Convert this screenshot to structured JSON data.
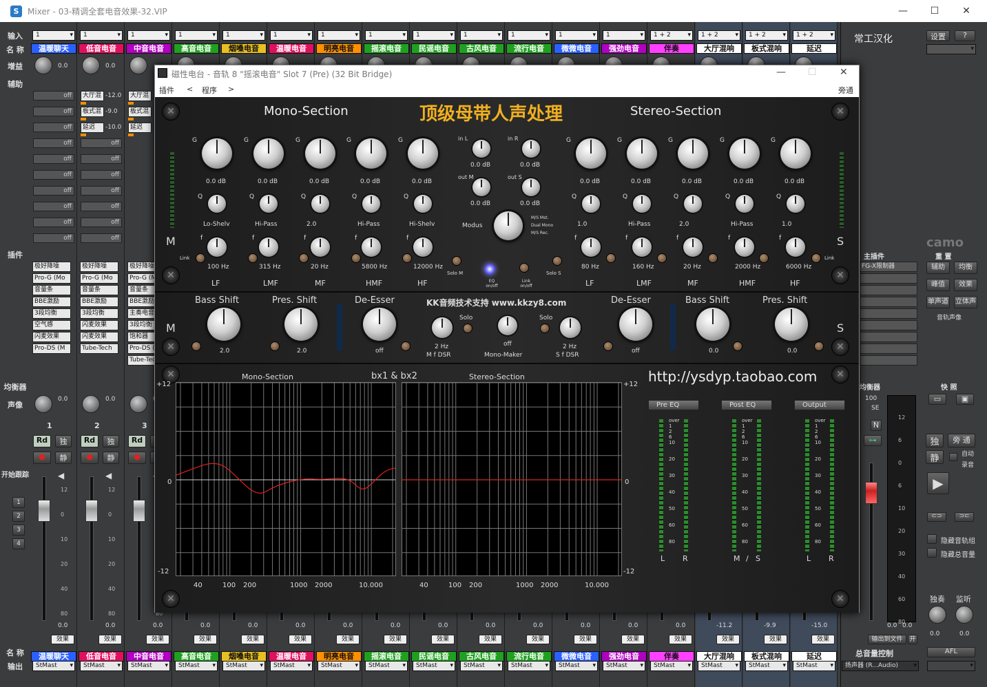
{
  "window": {
    "title": "Mixer - 03-精调全套电音效果-32.VIP",
    "icon_letter": "S"
  },
  "top_labels": {
    "input": "输入",
    "name": "名 称",
    "gain": "增益",
    "aux": "辅助",
    "insert": "插件",
    "eq": "均衡器",
    "pan": "声像",
    "start_follow": "开始跟踪",
    "name_bottom": "名 称",
    "output": "输出"
  },
  "strips": [
    {
      "num": "1",
      "input": "1",
      "name": "温暖聊天",
      "color": "#2a60ff",
      "text": "#fff",
      "gain": "0.0",
      "pan": "0.0",
      "sends": [],
      "inserts": [
        "极好降噪",
        "Pro-G (Mo",
        "音量条",
        "BBE激励",
        "3段均衡",
        "空气感",
        "闪麦效果",
        "Pro-DS (M"
      ],
      "vol": "0.0",
      "out": "StMast"
    },
    {
      "num": "2",
      "input": "1",
      "name": "低音电音",
      "color": "#e01060",
      "text": "#fff",
      "gain": "0.0",
      "pan": "0.0",
      "sends": [
        {
          "n": "大厅混",
          "v": "-12.0"
        },
        {
          "n": "板式混",
          "v": "-9.0"
        },
        {
          "n": "延迟",
          "v": "-10.0"
        }
      ],
      "inserts": [
        "极好降噪",
        "Pro-G (Mo",
        "音量条",
        "BBE激励",
        "3段均衡",
        "闪麦效果",
        "闪麦效果",
        "Tube-Tech"
      ],
      "vol": "0.0",
      "out": "StMast"
    },
    {
      "num": "3",
      "input": "1",
      "name": "中音电音",
      "color": "#b000c0",
      "text": "#fff",
      "gain": "",
      "pan": "0.0",
      "sends": [
        {
          "n": "大厅混",
          "v": ""
        },
        {
          "n": "板式混",
          "v": ""
        },
        {
          "n": "延迟",
          "v": ""
        }
      ],
      "inserts": [
        "极好降噪",
        "Pro-G (Mo",
        "音量条",
        "BBE激励",
        "主奏电音",
        "3段均衡",
        "饱和器",
        "Pro-DS (M",
        "Tube-Tec"
      ],
      "vol": "0.0",
      "out": "StMast"
    },
    {
      "num": "",
      "input": "1",
      "name": "高音电音",
      "color": "#20a020",
      "text": "#fff",
      "gain": "",
      "pan": "",
      "vol": "0.0",
      "out": "StMast"
    },
    {
      "num": "",
      "input": "1",
      "name": "烟嗓电音",
      "color": "#e8c020",
      "text": "#111",
      "gain": "",
      "pan": "",
      "vol": "0.0",
      "out": "StMast"
    },
    {
      "num": "",
      "input": "1",
      "name": "温暖电音",
      "color": "#e01060",
      "text": "#fff",
      "gain": "",
      "pan": "",
      "vol": "0.0",
      "out": "StMast"
    },
    {
      "num": "",
      "input": "1",
      "name": "明亮电音",
      "color": "#ff9000",
      "text": "#111",
      "gain": "",
      "pan": "",
      "vol": "0.0",
      "out": "StMast"
    },
    {
      "num": "",
      "input": "1",
      "name": "摇滚电音",
      "color": "#20a020",
      "text": "#fff",
      "gain": "",
      "pan": "",
      "vol": "0.0",
      "out": "StMast"
    },
    {
      "num": "",
      "input": "1",
      "name": "民谣电音",
      "color": "#20a020",
      "text": "#fff",
      "gain": "",
      "pan": "",
      "vol": "0.0",
      "out": "StMast"
    },
    {
      "num": "",
      "input": "1",
      "name": "古风电音",
      "color": "#20a020",
      "text": "#fff",
      "gain": "",
      "pan": "",
      "vol": "0.0",
      "out": "StMast"
    },
    {
      "num": "",
      "input": "1",
      "name": "流行电音",
      "color": "#20a020",
      "text": "#fff",
      "gain": "",
      "pan": "",
      "vol": "0.0",
      "out": "StMast"
    },
    {
      "num": "",
      "input": "1",
      "name": "微微电音",
      "color": "#2a60ff",
      "text": "#fff",
      "gain": "",
      "pan": "",
      "vol": "0.0",
      "out": "StMast"
    },
    {
      "num": "",
      "input": "1",
      "name": "强劲电音",
      "color": "#b000c0",
      "text": "#fff",
      "gain": "",
      "pan": "",
      "vol": "0.0",
      "out": "StMast"
    },
    {
      "num": "",
      "input": "1 + 2",
      "name": "伴奏",
      "color": "#ff40ff",
      "text": "#111",
      "gain": "",
      "pan": "",
      "vol": "0.0",
      "out": "StMast"
    },
    {
      "num": "",
      "input": "1 + 2",
      "name": "大厅混响",
      "color": "#ffffff",
      "text": "#111",
      "gain": "",
      "pan": "",
      "vol": "-11.2",
      "out": "StMast"
    },
    {
      "num": "",
      "input": "1 + 2",
      "name": "板式混响",
      "color": "#ffffff",
      "text": "#111",
      "gain": "",
      "pan": "",
      "vol": "-9.9",
      "out": "StMast"
    },
    {
      "num": "",
      "input": "1 + 2",
      "name": "延迟",
      "color": "#ffffff",
      "text": "#111",
      "gain": "",
      "pan": "",
      "vol": "-15.0",
      "out": "StMast"
    }
  ],
  "master": {
    "brand": "常工汉化",
    "settings": "设置",
    "help": "?",
    "master_insert": "主插件",
    "insert_name": "FG-X限制器",
    "rec_label": "重 置",
    "buttons": [
      "辅助",
      "均衡",
      "峰值",
      "效果",
      "单声道",
      "立体声"
    ],
    "pan_label": "音轨声像",
    "eq_label": "均衡器",
    "pan_value": "100",
    "se": "SE",
    "quick": "快 照",
    "solo": "独",
    "bypass": "旁 通",
    "mute": "静",
    "auto": "自动",
    "record": "录音",
    "hide_track": "隐藏音轨组",
    "hide_total": "隐藏总音量",
    "solo_label": "独奏",
    "monitor": "监听",
    "monitor_v": "0.0",
    "solo_v": "0.0",
    "to_file": "输出到文件",
    "on": "开",
    "master_name": "总音量控制",
    "out_device": "扬声器 (R...Audio)",
    "afl": "AFL",
    "master_vol": "0.0",
    "master_vol2": "0.0",
    "camo": "camo",
    "pan_small": "0.0"
  },
  "labels": {
    "off": "off",
    "rd": "Rd",
    "solo": "独",
    "mute": "静",
    "effect": "效果",
    "n": "N"
  },
  "plugin": {
    "title": "磁性电台 - 音轨 8  \"摇滚电音\" Slot 7 (Pre) (32 Bit Bridge)",
    "menu_plugin": "插件",
    "menu_prev": "<",
    "menu_program": "程序",
    "menu_next": ">",
    "bypass": "旁通",
    "mono_section": "Mono-Section",
    "stereo_section": "Stereo-Section",
    "banner": "顶级母带人声处理",
    "gain_vals": [
      "0.0 dB",
      "0.0 dB",
      "0.0 dB",
      "0.0 dB",
      "0.0 dB",
      "0.0 dB",
      "0.0 dB",
      "0.0 dB",
      "0.0 dB",
      "0.0 dB"
    ],
    "mono_q": [
      "Lo-Shelv",
      "Hi-Pass",
      "2.0",
      "Hi-Pass",
      "Hi-Shelv"
    ],
    "stereo_q": [
      "1.0",
      "Hi-Pass",
      "2.0",
      "Hi-Pass",
      "1.0"
    ],
    "mono_f": [
      "100 Hz",
      "315 Hz",
      "20 Hz",
      "5800 Hz",
      "12000 Hz"
    ],
    "stereo_f": [
      "80 Hz",
      "160 Hz",
      "20 Hz",
      "2000 Hz",
      "6000 Hz"
    ],
    "bands": [
      "LF",
      "LMF",
      "MF",
      "HMF",
      "HF"
    ],
    "in_l": "in L",
    "in_r": "in R",
    "out_m": "out M",
    "out_s": "out S",
    "io_vals": [
      "0.0 dB",
      "0.0 dB",
      "0.0 dB",
      "0.0 dB"
    ],
    "modus": "Modus",
    "modus_opts": [
      "M/S Mst.",
      "Dual Mono",
      "M/S Rec."
    ],
    "solo_m": "Solo M",
    "eq_onoff": "EQ on/off",
    "link_onoff": "Link on/off",
    "solo_s": "Solo S",
    "g": "G",
    "q": "Q",
    "f": "f",
    "link": "Link",
    "m": "M",
    "s": "S",
    "bass_shift": "Bass Shift",
    "pres_shift": "Pres. Shift",
    "de_esser": "De-Esser",
    "support": "KK音频技术支持 www.kkzy8.com",
    "mid_vals": [
      "2.0",
      "2.0",
      "off"
    ],
    "stereo_mid_vals": [
      "off",
      "0.0",
      "0.0"
    ],
    "solo": "Solo",
    "hz2": "2 Hz",
    "m_dsr": "M f DSR",
    "s_dsr": "S f DSR",
    "mono_maker": "Mono-Maker",
    "mm_val": "off",
    "hz2b": "2 Hz",
    "graph_mono": "Mono-Section",
    "graph_title": "bx1 & bx2",
    "graph_stereo": "Stereo-Section",
    "url": "http://ysdyp.taobao.com",
    "y_top": "+12",
    "y_mid": "0",
    "y_bot": "-12",
    "x_ticks": [
      "40",
      "100",
      "200",
      "1000",
      "2000",
      "10.000"
    ],
    "meters": [
      "Pre EQ",
      "Post EQ",
      "Output"
    ],
    "meter_lr": [
      "L",
      "R",
      "M",
      "/",
      "S",
      "L",
      "R"
    ],
    "meter_scale": [
      "over",
      "1",
      "2",
      "6",
      "10",
      "20",
      "30",
      "40",
      "50",
      "60",
      "80"
    ]
  }
}
